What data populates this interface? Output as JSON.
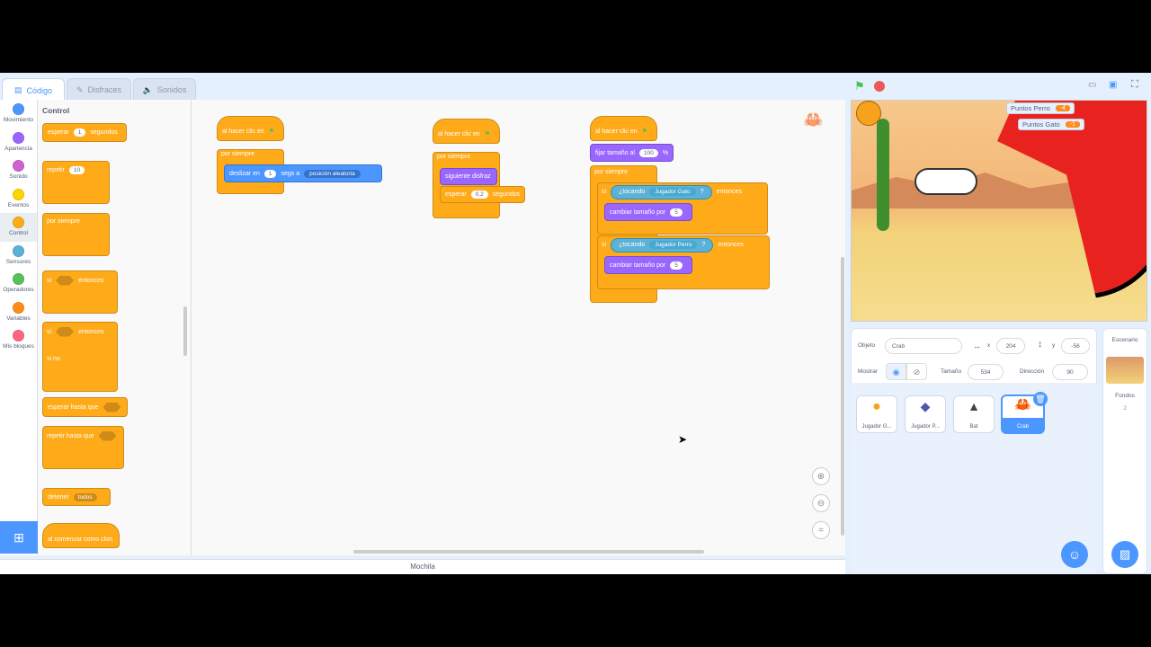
{
  "tabs": [
    {
      "label": "Código"
    },
    {
      "label": "Disfraces"
    },
    {
      "label": "Sonidos"
    }
  ],
  "categories": [
    {
      "label": "Movimiento",
      "color": "#4c97ff"
    },
    {
      "label": "Apariencia",
      "color": "#9966ff"
    },
    {
      "label": "Sonido",
      "color": "#cf63cf"
    },
    {
      "label": "Eventos",
      "color": "#ffd500"
    },
    {
      "label": "Control",
      "color": "#ffab19"
    },
    {
      "label": "Sensores",
      "color": "#5cb1d6"
    },
    {
      "label": "Operadores",
      "color": "#59c059"
    },
    {
      "label": "Variables",
      "color": "#ff8c1a"
    },
    {
      "label": "Mis bloques",
      "color": "#ff6680"
    }
  ],
  "palette": {
    "heading": "Control",
    "wait": {
      "a": "esperar",
      "v": "1",
      "b": "segundos"
    },
    "repeat": {
      "a": "repetir",
      "v": "10"
    },
    "forever": "por siempre",
    "if": {
      "a": "si",
      "b": "entonces"
    },
    "ifelse": {
      "a": "si",
      "b": "entonces",
      "c": "si no"
    },
    "waituntil": "esperar hasta que",
    "repeatuntil": "repetir hasta que",
    "stop": {
      "a": "detener",
      "v": "todos"
    },
    "clone": "al comenzar como clon"
  },
  "scripts": {
    "s1": {
      "hat": "al hacer clic en",
      "forever": "por siempre",
      "glide": "deslizar en",
      "secs": "1",
      "secs_label": "segs a",
      "target": "posición aleatoria"
    },
    "s2": {
      "hat": "al hacer clic en",
      "forever": "por siempre",
      "next": "siguiente disfraz",
      "wait": "esperar",
      "wait_v": "0.2",
      "wait_b": "segundos"
    },
    "s3": {
      "hat": "al hacer clic en",
      "setsize": "fijar tamaño al",
      "setsize_v": "100",
      "pct": "%",
      "forever": "por siempre",
      "if1": {
        "si": "si",
        "touch": "¿tocando",
        "obj": "Jugador Gato",
        "q": "?",
        "then": "entonces",
        "change": "cambiar tamaño por",
        "v": "5"
      },
      "if2": {
        "si": "si",
        "touch": "¿tocando",
        "obj": "Jugador Perro",
        "q": "?",
        "then": "entonces",
        "change": "cambiar tamaño por",
        "v": "5"
      }
    }
  },
  "backpack": "Mochila",
  "monitors": [
    {
      "label": "Puntos Perro",
      "value": "-4"
    },
    {
      "label": "Puntos Gato",
      "value": "-1"
    }
  ],
  "sprite_info": {
    "object_label": "Objeto",
    "name": "Crab",
    "x_label": "x",
    "x": "204",
    "y_label": "y",
    "y": "-56",
    "show_label": "Mostrar",
    "size_label": "Tamaño",
    "size": "534",
    "dir_label": "Dirección",
    "dir": "90"
  },
  "sprites": [
    {
      "name": "Jugador G..."
    },
    {
      "name": "Jugador P..."
    },
    {
      "name": "Bat"
    },
    {
      "name": "Crab"
    }
  ],
  "stage_panel": {
    "title": "Escenario",
    "backdrops_label": "Fondos",
    "backdrops": "2"
  }
}
